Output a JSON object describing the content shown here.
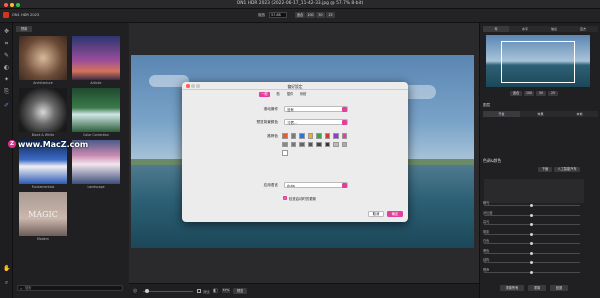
{
  "window": {
    "title": "ON1 HDR 2023 (2022-06-17_11-42-33.jpg @ 57.7% 8-bit)"
  },
  "app": {
    "name": "ON1 HDR 2023"
  },
  "appbar": {
    "zoom_label": "缩放",
    "zoom_value": "57.68",
    "fit_btn": "适合",
    "z100": "100",
    "z50": "50",
    "z25": "25"
  },
  "browser": {
    "tab": "预置",
    "thumbs": [
      {
        "label": "Architecture"
      },
      {
        "label": "Artistic"
      },
      {
        "label": "Black & White"
      },
      {
        "label": "Color Correction"
      },
      {
        "label": "Fundamentals"
      },
      {
        "label": "Landscape"
      },
      {
        "label": "Modern"
      }
    ],
    "thumb_magic": "MAGIC",
    "search_placeholder": "搜索"
  },
  "watermark": "www.MacZ.com",
  "dialog": {
    "title": "偏好設定",
    "tabs": [
      "一般",
      "档",
      "插件",
      "系统"
    ],
    "rows": {
      "scroll_label": "滚动操作",
      "scroll_value": "没有",
      "bg_label": "预览背景颜色",
      "bg_value": "习惯...",
      "swatch_label": "推荐色",
      "lang_label": "应用语言",
      "lang_value": "Auto"
    },
    "checkbox_label": "检查启动时的更新",
    "cancel": "取消",
    "ok": "确定"
  },
  "swatch_colors": [
    "#e85d2a",
    "#7b7b7b",
    "#2b73d9",
    "#e0b520",
    "#3aa64a",
    "#d23a3a",
    "#8d3bd1",
    "#e83f9a",
    "#888888",
    "#777777",
    "#666666",
    "#555555",
    "#444444",
    "#333333",
    "#bbbbbb",
    "#aaaaaa",
    "#ffffff"
  ],
  "bottombar": {
    "compare": "对比",
    "zoom_pct": "57%",
    "preview_btn": "预览"
  },
  "right": {
    "nav_tabs": [
      "导",
      "水平",
      "信息",
      "直方"
    ],
    "nav_bottom": [
      "适合",
      "100",
      "50",
      "25"
    ],
    "panel_title": "图层",
    "panel_tabs": [
      "开发",
      "效果",
      "本地"
    ],
    "section": "色调&颜色",
    "auto_btns": [
      "下面",
      "人工智能汽车"
    ],
    "sliders": [
      "曝光",
      "对比度",
      "高光",
      "阴影",
      "白色",
      "黑色",
      "结构",
      "嘈声"
    ],
    "footer": [
      "重置所有",
      "重置",
      "回退"
    ]
  },
  "accent": "#e1409a"
}
